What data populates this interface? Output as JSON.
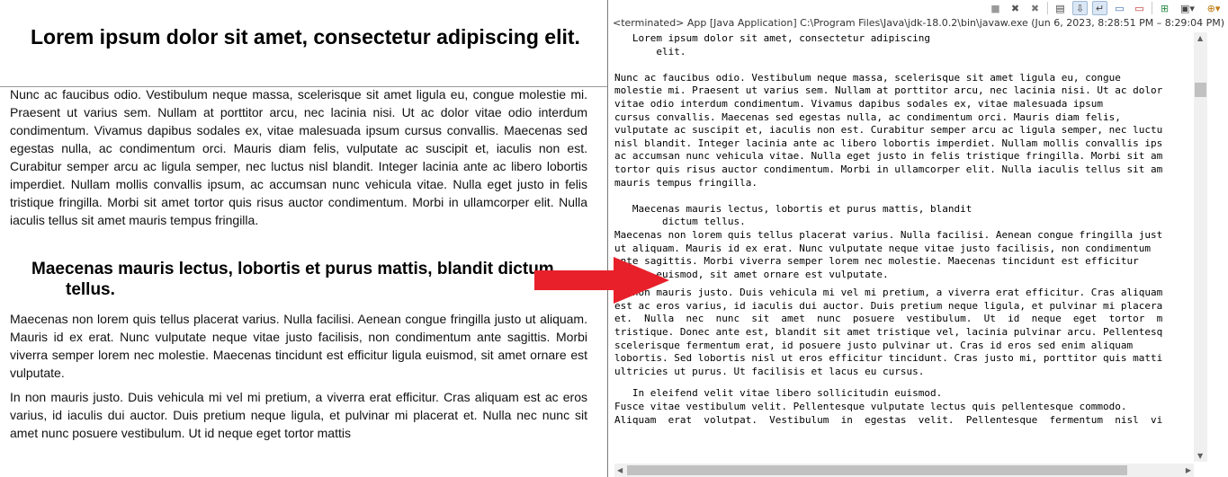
{
  "document": {
    "heading1": "Lorem ipsum dolor sit amet, consectetur adipiscing elit.",
    "paragraph1": "Nunc ac faucibus odio. Vestibulum neque massa, scelerisque sit amet ligula eu, congue molestie mi. Praesent ut varius sem. Nullam at porttitor arcu, nec lacinia nisi. Ut ac dolor vitae odio interdum condimentum. Vivamus dapibus sodales ex, vitae malesuada ipsum cursus convallis. Maecenas sed egestas nulla, ac condimentum orci. Mauris diam felis, vulputate ac suscipit et, iaculis non est. Curabitur semper arcu ac ligula semper, nec luctus nisl blandit. Integer lacinia ante ac libero lobortis imperdiet. Nullam mollis convallis ipsum, ac accumsan nunc vehicula vitae. Nulla eget justo in felis tristique fringilla. Morbi sit amet tortor quis risus auctor condimentum. Morbi in ullamcorper elit. Nulla iaculis tellus sit amet mauris tempus fringilla.",
    "heading2": "Maecenas mauris lectus, lobortis et purus mattis, blandit dictum tellus.",
    "paragraph2": "Maecenas non lorem quis tellus placerat varius. Nulla facilisi. Aenean congue fringilla justo ut aliquam. Mauris id ex erat. Nunc vulputate neque vitae justo facilisis, non condimentum ante sagittis. Morbi viverra semper lorem nec molestie. Maecenas tincidunt est efficitur ligula euismod, sit amet ornare est vulputate.",
    "paragraph3": "In non mauris justo. Duis vehicula mi vel mi pretium, a viverra erat efficitur. Cras aliquam est ac eros varius, id iaculis dui auctor. Duis pretium neque ligula, et pulvinar mi placerat et. Nulla nec nunc sit amet nunc posuere vestibulum. Ut id neque eget tortor mattis"
  },
  "console": {
    "status": "<terminated> App [Java Application] C:\\Program Files\\Java\\jdk-18.0.2\\bin\\javaw.exe  (Jun 6, 2023, 8:28:51 PM – 8:29:04 PM) [p",
    "blocks": [
      "   Lorem ipsum dolor sit amet, consectetur adipiscing\n       elit.",
      "",
      "Nunc ac faucibus odio. Vestibulum neque massa, scelerisque sit amet ligula eu, congue\nmolestie mi. Praesent ut varius sem. Nullam at porttitor arcu, nec lacinia nisi. Ut ac dolor\nvitae odio interdum condimentum. Vivamus dapibus sodales ex, vitae malesuada ipsum\ncursus convallis. Maecenas sed egestas nulla, ac condimentum orci. Mauris diam felis,\nvulputate ac suscipit et, iaculis non est. Curabitur semper arcu ac ligula semper, nec luctu\nnisl blandit. Integer lacinia ante ac libero lobortis imperdiet. Nullam mollis convallis ips\nac accumsan nunc vehicula vitae. Nulla eget justo in felis tristique fringilla. Morbi sit am\ntortor quis risus auctor condimentum. Morbi in ullamcorper elit. Nulla iaculis tellus sit am\nmauris tempus fringilla.",
      "",
      "   Maecenas mauris lectus, lobortis et purus mattis, blandit\n        dictum tellus.\nMaecenas non lorem quis tellus placerat varius. Nulla facilisi. Aenean congue fringilla just\nut aliquam. Mauris id ex erat. Nunc vulputate neque vitae justo facilisis, non condimentum\nante sagittis. Morbi viverra semper lorem nec molestie. Maecenas tincidunt est efficitur\nligula euismod, sit amet ornare est vulputate.",
      "In non mauris justo. Duis vehicula mi vel mi pretium, a viverra erat efficitur. Cras aliquam\nest ac eros varius, id iaculis dui auctor. Duis pretium neque ligula, et pulvinar mi placera\net.  Nulla  nec  nunc  sit  amet  nunc  posuere  vestibulum.  Ut  id  neque  eget  tortor  m\ntristique. Donec ante est, blandit sit amet tristique vel, lacinia pulvinar arcu. Pellentesq\nscelerisque fermentum erat, id posuere justo pulvinar ut. Cras id eros sed enim aliquam\nlobortis. Sed lobortis nisl ut eros efficitur tincidunt. Cras justo mi, porttitor quis matti\nultricies ut purus. Ut facilisis et lacus eu cursus.",
      "   In eleifend velit vitae libero sollicitudin euismod.\nFusce vitae vestibulum velit. Pellentesque vulputate lectus quis pellentesque commodo.\nAliquam  erat  volutpat.  Vestibulum  in  egestas  velit.  Pellentesque  fermentum  nisl  vi"
    ]
  },
  "toolbar": {
    "icons": [
      "terminate-icon",
      "remove-launch-icon",
      "remove-all-icon",
      "clear-console-icon",
      "scroll-lock-icon",
      "word-wrap-icon",
      "show-stdout-icon",
      "show-stderr-icon",
      "pin-console-icon",
      "display-console-icon",
      "open-console-icon"
    ],
    "glyphs": {
      "terminate": "■",
      "remove": "✖",
      "remove_all": "✖",
      "clear": "▤",
      "scroll_lock": "⇩",
      "word_wrap": "↵",
      "stdout": "▭",
      "stderr": "▭",
      "pin": "⊞",
      "display": "▣▾",
      "open": "⊕▾"
    }
  },
  "colors": {
    "arrow": "#e8202a",
    "console_text": "#000000",
    "status_text": "#333333",
    "toolbar_active": "#dbe7f5"
  }
}
